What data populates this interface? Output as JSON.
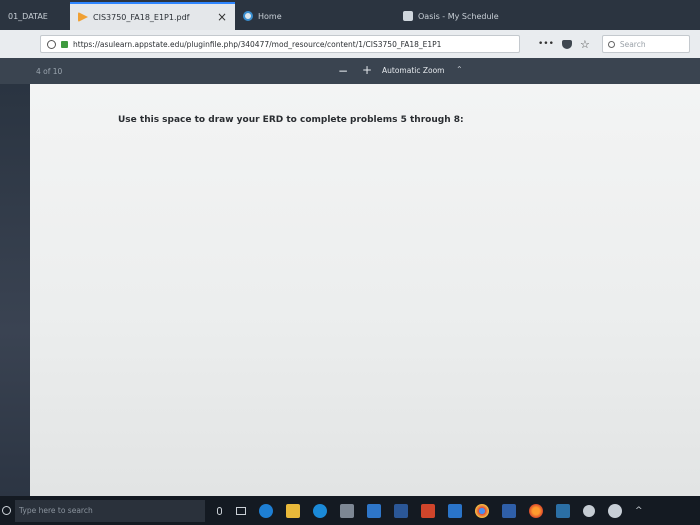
{
  "tabs": [
    {
      "label": "01_DATAE"
    },
    {
      "label": "CIS3750_FA18_E1P1.pdf",
      "close": "×"
    },
    {
      "label": "Home"
    },
    {
      "label": "Oasis - My Schedule",
      "close": "×"
    }
  ],
  "navbar": {
    "url": "https://asulearn.appstate.edu/pluginfile.php/340477/mod_resource/content/1/CIS3750_FA18_E1P1",
    "more": "•••",
    "search_placeholder": "Search"
  },
  "pdf_toolbar": {
    "page_indicator": "4  of 10",
    "zoom_out": "−",
    "zoom_in": "+",
    "zoom_level": "Automatic Zoom",
    "zoom_chevron": "⌃"
  },
  "page": {
    "instruction": "Use this space to draw your ERD to complete problems 5 through 8:"
  },
  "taskbar": {
    "search_placeholder": "Type here to search"
  },
  "colors": {
    "active_tab_accent": "#2f86ff",
    "toolbar": "#3a4450",
    "taskbar": "#141a22"
  }
}
